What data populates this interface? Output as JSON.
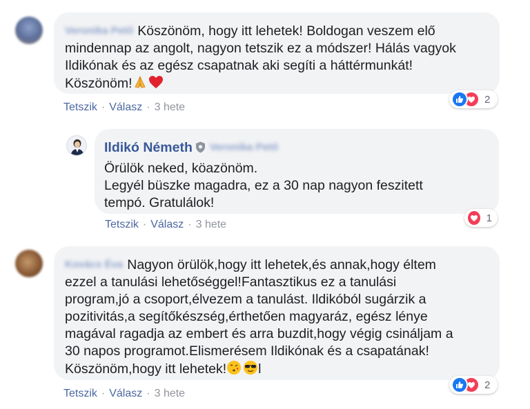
{
  "comments": [
    {
      "author_blurred": "Veronika Pető",
      "text_lines": [
        "Köszönöm, hogy itt lehetek! Boldogan veszem elő",
        "mindennap az angolt, nagyon tetszik ez a módszer! Hálás vagyok",
        "Ildikónak és az egész csapatnak aki segíti a háttérmunkát!",
        "Köszönöm!"
      ],
      "end_emojis": [
        "folded-hands-emoji",
        "red-heart-emoji"
      ],
      "like_label": "Tetszik",
      "reply_label": "Válasz",
      "time": "3 hete",
      "reaction_count": "2",
      "reaction_types": [
        "like-icon",
        "love-icon"
      ]
    },
    {
      "author": "Ildikó Németh",
      "reply_to_blurred": "Veronika Pető",
      "text_lines": [
        "Örülök neked, köazönöm.",
        "Legyél büszke magadra, ez a 30 nap nagyon feszitett",
        "tempó. Gratulálok!"
      ],
      "like_label": "Tetszik",
      "reply_label": "Válasz",
      "time": "3 hete",
      "reaction_count": "1",
      "reaction_types": [
        "love-icon"
      ]
    },
    {
      "author_blurred": "Kovács Éva",
      "text_lines": [
        "Nagyon örülök,hogy itt lehetek,és annak,hogy éltem",
        "ezzel a tanulási lehetőséggel!Fantasztikus ez a tanulási",
        "program,jó a csoport,élvezem a tanulást. Ildikóból sugárzik a",
        "pozitivitás,a segítőkészség,érthetően magyaráz, egész lénye",
        "magával ragadja az embert és arra buzdit,hogy végig csináljam a",
        "30 napos programot.Elismerésem Ildikónak és a csapatának!",
        "Köszönöm,hogy itt lehetek!"
      ],
      "end_emojis": [
        "face-blowing-kiss-emoji",
        "sunglasses-face-emoji"
      ],
      "trailing_text": "l",
      "like_label": "Tetszik",
      "reply_label": "Válasz",
      "time": "3 hete",
      "reaction_count": "2",
      "reaction_types": [
        "like-icon",
        "love-icon"
      ]
    }
  ],
  "separator": "·",
  "colors": {
    "bubble_bg": "#f2f3f5",
    "author_link": "#385898",
    "action_link": "#4b67a1",
    "muted": "#90949c",
    "like_blue": "#1877f2",
    "love_red": "#f33e58"
  }
}
